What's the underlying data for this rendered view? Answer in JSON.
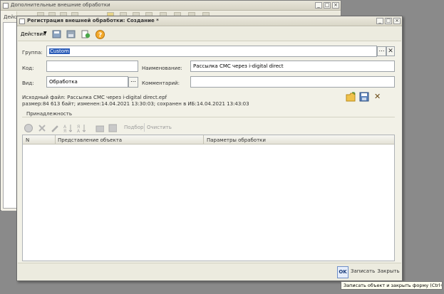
{
  "background_window": {
    "title": "Дополнительные внешние обработки",
    "left_label": "Дейс"
  },
  "dialog": {
    "title": "Регистрация внешней обработки: Создание *",
    "actions_label": "Действия",
    "fields": {
      "group_label": "Группа:",
      "group_value": "Custom",
      "code_label": "Код:",
      "code_value": "",
      "name_label": "Наименование:",
      "name_value": "Рассылка СМС через i-digital direct",
      "kind_label": "Вид:",
      "kind_value": "Обработка",
      "comment_label": "Комментарий:",
      "comment_value": ""
    },
    "source_file_line1": "Исходный файл: Рассылка СМС через i-digital direct.epf",
    "source_file_line2": "размер:84 613 байт; изменен:14.04.2021 13:30:03; сохранен в ИБ:14.04.2021 13:43:03",
    "tab_label": "Принадлежность",
    "table_toolbar": {
      "select_label": "Подбор",
      "clear_label": "Очистить"
    },
    "table": {
      "columns": [
        "N",
        "Представление объекта",
        "Параметры обработки"
      ],
      "rows": []
    },
    "footer": {
      "ok_label": "OK",
      "save_label": "Записать",
      "close_label": "Закрыть"
    }
  },
  "tooltip": "Записать объект и закрыть форму (Ctrl+Enter)"
}
